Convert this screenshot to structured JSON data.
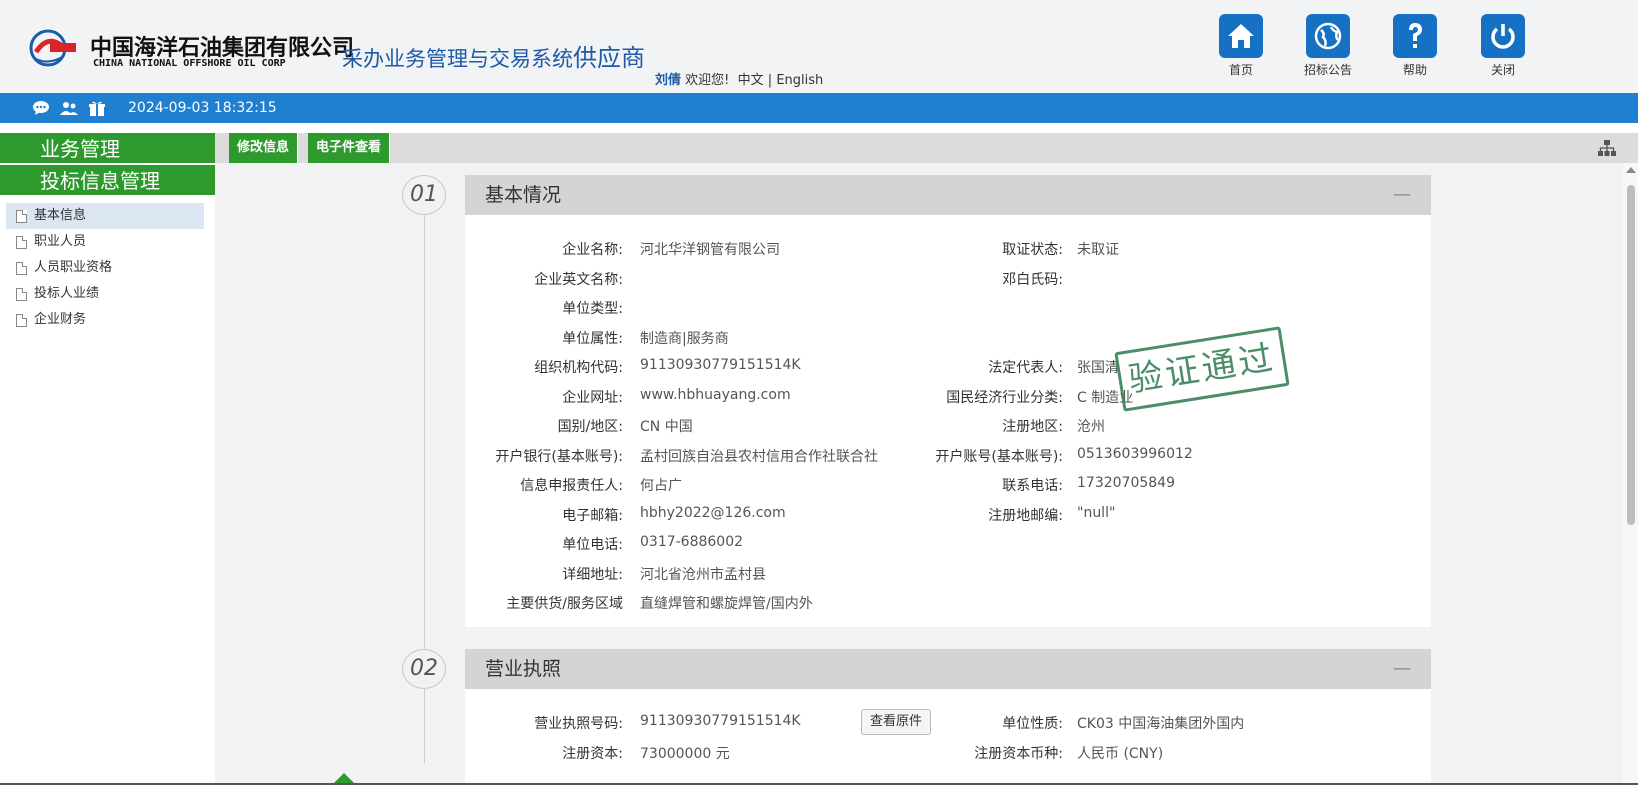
{
  "header": {
    "brand_cn": "中国海洋石油集团有限公司",
    "brand_en": "CHINA NATIONAL OFFSHORE OIL CORP",
    "system_title": "采办业务管理与交易系统",
    "system_suffix": "供应商",
    "user_name": "刘倩",
    "welcome_text": "欢迎您!",
    "lang_cn": "中文",
    "lang_sep": "|",
    "lang_en": "English",
    "buttons": [
      {
        "label": "首页",
        "icon": "home-icon"
      },
      {
        "label": "招标公告",
        "icon": "globe-icon"
      },
      {
        "label": "帮助",
        "icon": "help-icon"
      },
      {
        "label": "关闭",
        "icon": "power-icon"
      }
    ]
  },
  "bluebar": {
    "datetime": "2024-09-03 18:32:15",
    "icons": [
      "chat-icon",
      "users-icon",
      "gift-icon"
    ]
  },
  "sidebar": {
    "section1": "业务管理",
    "section2": "投标信息管理",
    "items": [
      "基本信息",
      "职业人员",
      "人员职业资格",
      "投标人业绩",
      "企业财务"
    ]
  },
  "toolbar": {
    "edit_label": "修改信息",
    "efile_label": "电子件查看"
  },
  "colors": {
    "brand_blue": "#1f7fd1",
    "nav_green": "#2e9a2e",
    "stamp_green": "#2d7a4f"
  },
  "sections": [
    {
      "num": "01",
      "title": "基本情况",
      "collapse": "—",
      "stamp": "验证通过",
      "left_fields": [
        {
          "label": "企业名称:",
          "value": "河北华洋钢管有限公司"
        },
        {
          "label": "企业英文名称:",
          "value": ""
        },
        {
          "label": "单位类型:",
          "value": ""
        },
        {
          "label": "单位属性:",
          "value": "制造商|服务商"
        },
        {
          "label": "组织机构代码:",
          "value": "91130930779151514K"
        },
        {
          "label": "企业网址:",
          "value": "www.hbhuayang.com"
        },
        {
          "label": "国别/地区:",
          "value": "CN 中国"
        },
        {
          "label": "开户银行(基本账号):",
          "value": "孟村回族自治县农村信用合作社联合社"
        },
        {
          "label": "信息申报责任人:",
          "value": "何占广"
        },
        {
          "label": "电子邮箱:",
          "value": "hbhy2022@126.com"
        },
        {
          "label": "单位电话:",
          "value": "0317-6886002"
        },
        {
          "label": "详细地址:",
          "value": "河北省沧州市孟村县"
        },
        {
          "label": "主要供货/服务区域",
          "value": "直缝焊管和螺旋焊管/国内外"
        }
      ],
      "right_fields": [
        {
          "label": "取证状态:",
          "value": "未取证",
          "row": 0
        },
        {
          "label": "邓白氏码:",
          "value": "",
          "row": 1
        },
        {
          "label": "法定代表人:",
          "value": "张国清",
          "row": 4
        },
        {
          "label": "国民经济行业分类:",
          "value": "C 制造业",
          "row": 5
        },
        {
          "label": "注册地区:",
          "value": "沧州",
          "row": 6
        },
        {
          "label": "开户账号(基本账号):",
          "value": "0513603996012",
          "row": 7
        },
        {
          "label": "联系电话:",
          "value": "17320705849",
          "row": 8
        },
        {
          "label": "注册地邮编:",
          "value": "\"null\"",
          "row": 9
        }
      ]
    },
    {
      "num": "02",
      "title": "营业执照",
      "collapse": "—",
      "license_label": "营业执照号码:",
      "license_value": "91130930779151514K",
      "view_button": "查看原件",
      "nature_label": "单位性质:",
      "nature_value": "CK03 中国海油集团外国内",
      "capital_label": "注册资本:",
      "capital_value": "73000000 元",
      "currency_label": "注册资本币种:",
      "currency_value": "人民币 (CNY)"
    }
  ]
}
